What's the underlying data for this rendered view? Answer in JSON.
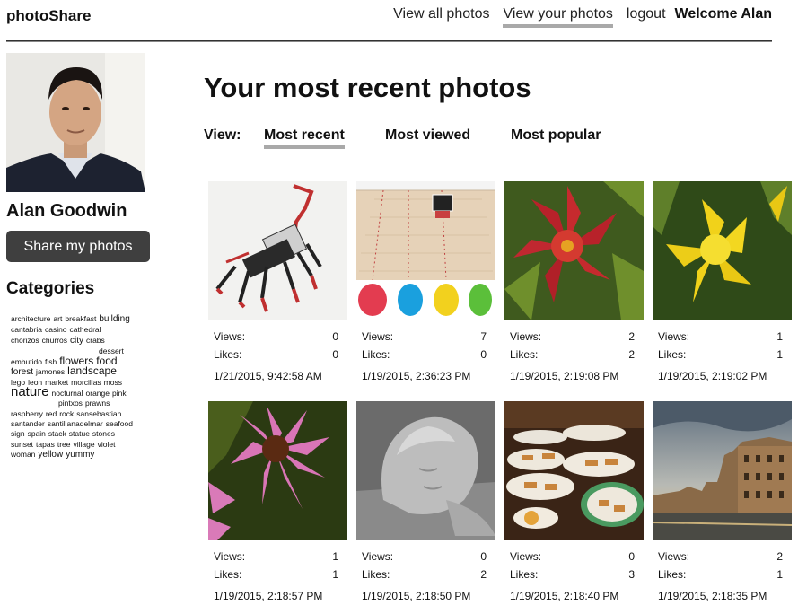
{
  "header": {
    "brand": "photoShare",
    "nav": [
      {
        "label": "View all photos"
      },
      {
        "label": "View your photos"
      },
      {
        "label": "logout"
      }
    ],
    "welcome": "Welcome Alan"
  },
  "sidebar": {
    "user_name": "Alan Goodwin",
    "share_button": "Share my photos",
    "categories_title": "Categories",
    "tags": [
      [
        "architecture",
        "art",
        "breakfast",
        "building"
      ],
      [
        "cantabria",
        "casino",
        "cathedral"
      ],
      [
        "chorizos",
        "churros",
        "city",
        "crabs"
      ],
      [
        "dessert"
      ],
      [
        "embutido",
        "fish",
        "flowers",
        "food"
      ],
      [
        "forest",
        "jamones",
        "landscape"
      ],
      [
        "lego",
        "leon",
        "market",
        "morcillas",
        "moss"
      ],
      [
        "nature",
        "nocturnal",
        "orange",
        "pink"
      ],
      [
        "pintxos",
        "prawns"
      ],
      [
        "raspberry",
        "red",
        "rock",
        "sansebastian"
      ],
      [
        "santander",
        "santillanadelmar",
        "seafood"
      ],
      [
        "sign",
        "spain",
        "stack",
        "statue",
        "stones"
      ],
      [
        "sunset",
        "tapas",
        "tree",
        "village",
        "violet"
      ],
      [
        "woman",
        "yellow",
        "yummy"
      ]
    ]
  },
  "main": {
    "title": "Your most recent photos",
    "view_label": "View:",
    "view_tabs": [
      "Most recent",
      "Most viewed",
      "Most popular"
    ],
    "views_label": "Views:",
    "likes_label": "Likes:",
    "photos": [
      {
        "image": "lego-robot-photo",
        "views": "0",
        "likes": "0",
        "date": "1/21/2015, 9:42:58 AM"
      },
      {
        "image": "robot-game-board-photo",
        "views": "7",
        "likes": "0",
        "date": "1/19/2015, 2:36:23 PM"
      },
      {
        "image": "red-lily-photo",
        "views": "2",
        "likes": "2",
        "date": "1/19/2015, 2:19:08 PM"
      },
      {
        "image": "yellow-lily-photo",
        "views": "1",
        "likes": "1",
        "date": "1/19/2015, 2:19:02 PM"
      },
      {
        "image": "pink-coneflower-photo",
        "views": "1",
        "likes": "1",
        "date": "1/19/2015, 2:18:57 PM"
      },
      {
        "image": "statue-head-photo",
        "views": "0",
        "likes": "2",
        "date": "1/19/2015, 2:18:50 PM"
      },
      {
        "image": "tapas-table-photo",
        "views": "0",
        "likes": "3",
        "date": "1/19/2015, 2:18:40 PM"
      },
      {
        "image": "sunset-village-photo",
        "views": "2",
        "likes": "1",
        "date": "1/19/2015, 2:18:35 PM"
      }
    ]
  }
}
